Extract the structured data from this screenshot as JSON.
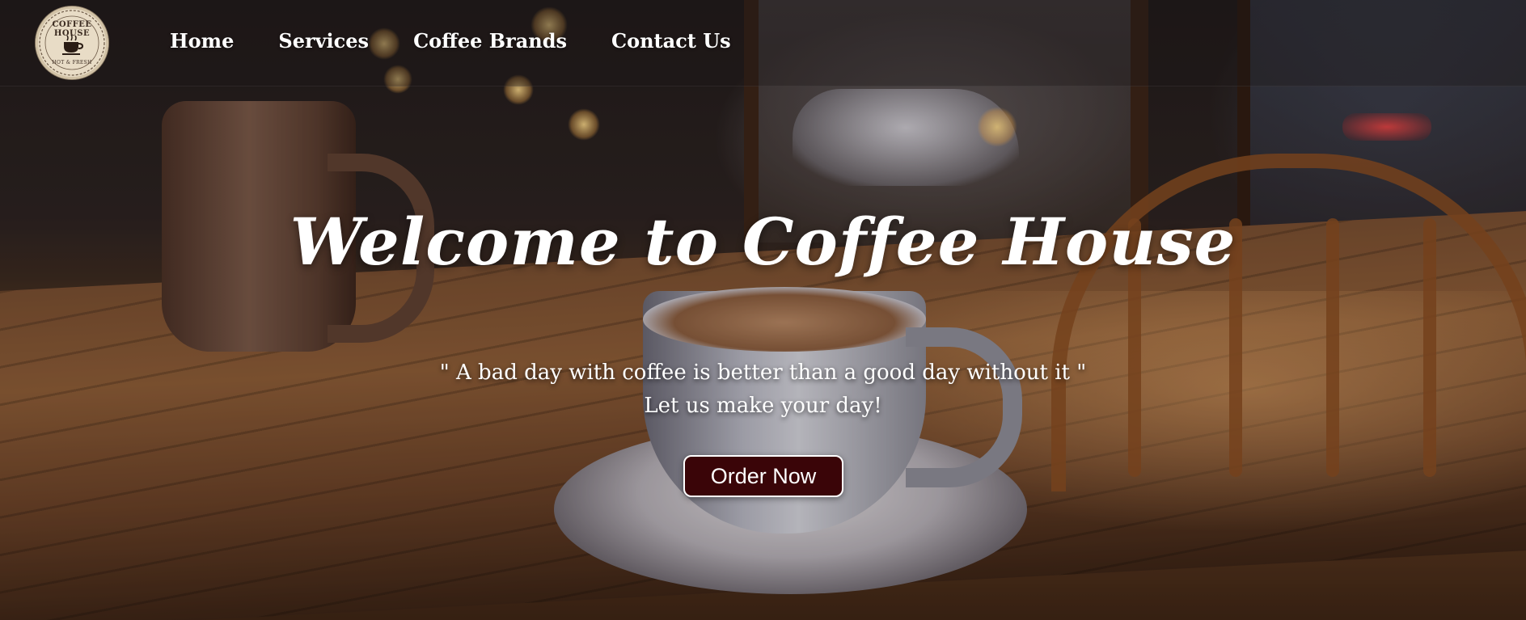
{
  "brand": {
    "logo_title": "COFFEE HOUSE",
    "logo_tagline": "HOT & FRESH",
    "logo_icon": "coffee-cup-icon"
  },
  "nav": {
    "items": [
      {
        "label": "Home"
      },
      {
        "label": "Services"
      },
      {
        "label": "Coffee Brands"
      },
      {
        "label": "Contact Us"
      }
    ]
  },
  "hero": {
    "title": "Welcome to Coffee House",
    "quote": "\" A bad day with coffee is better than a good day without it \"",
    "subline": "Let us make your day!",
    "cta_label": "Order Now"
  },
  "colors": {
    "cta_background": "#3a0508",
    "text": "#ffffff"
  }
}
